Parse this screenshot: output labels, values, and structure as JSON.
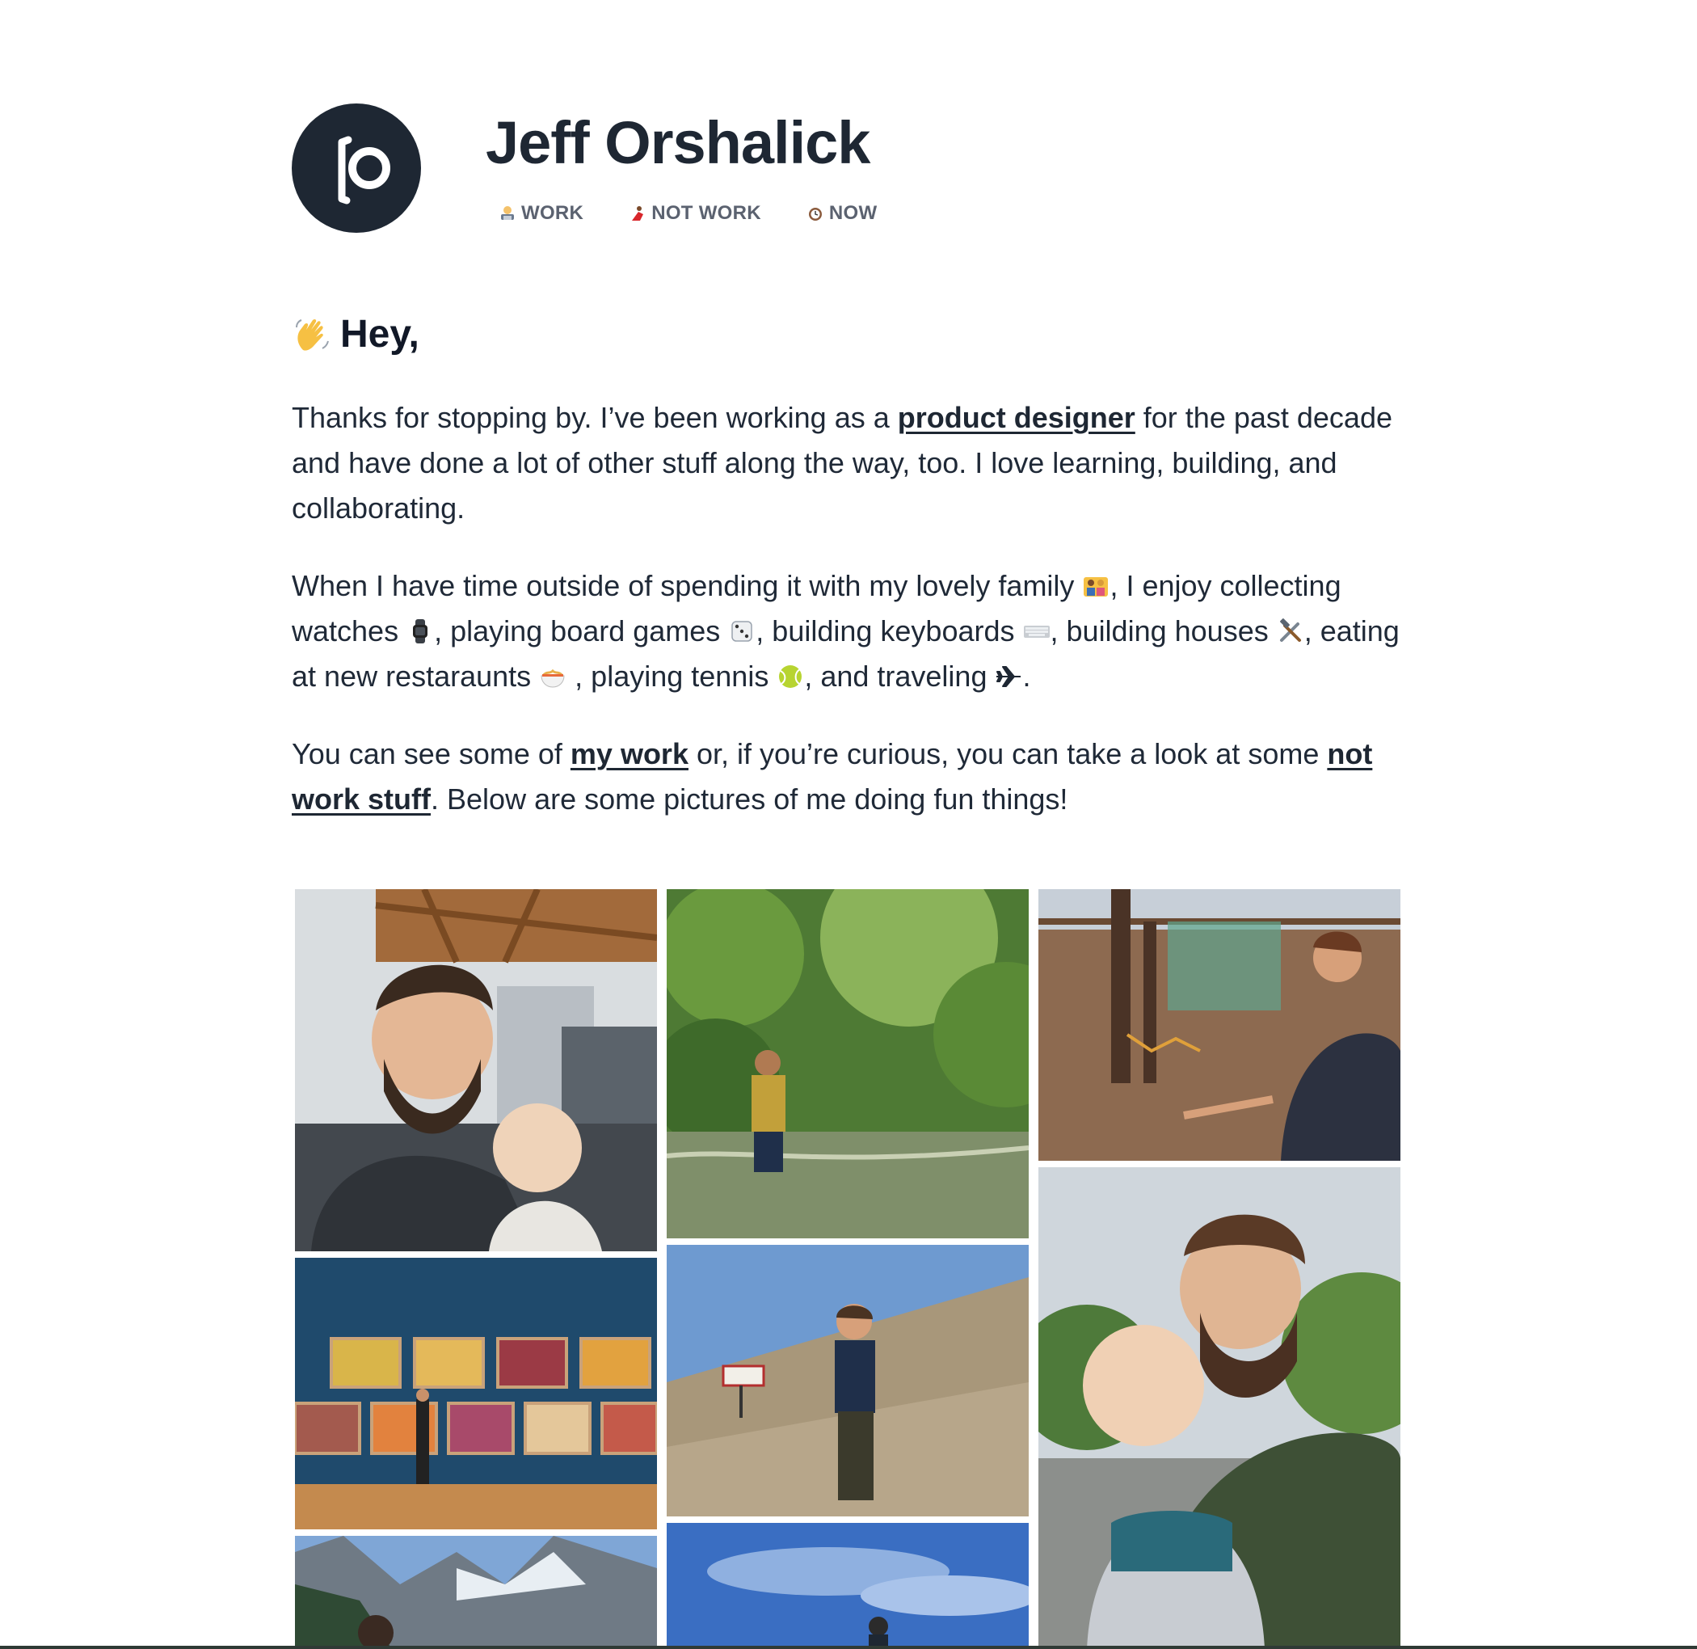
{
  "site": {
    "title": "Jeff Orshalick",
    "logo_icon": "jo-monogram-logo"
  },
  "nav": [
    {
      "label": "WORK",
      "icon": "technologist-icon"
    },
    {
      "label": "NOT WORK",
      "icon": "dancer-icon"
    },
    {
      "label": "NOW",
      "icon": "alarm-clock-icon"
    }
  ],
  "intro": {
    "greeting": "Hey,",
    "greeting_icon": "waving-hand-icon",
    "p1_before": "Thanks for stopping by. I’ve been working as a ",
    "p1_link": "product designer",
    "p1_after": " for the past decade and have done a lot of other stuff along the way, too. I love learning, building, and collaborating.",
    "p2_a": "When I have time outside of spending it with my lovely family ",
    "p2_b": ", I enjoy collecting watches ",
    "p2_c": ", playing board games ",
    "p2_d": ", building keyboards ",
    "p2_e": ", building houses ",
    "p2_f": ", eating at new restaraunts ",
    "p2_g": " , playing tennis ",
    "p2_h": ", and traveling ",
    "p2_i": ".",
    "p3_a": "You can see some of ",
    "p3_link1": "my work",
    "p3_b": " or, if you’re curious, you can take a look at some ",
    "p3_link2": "not work stuff",
    "p3_c": ". Below are some pictures of me doing fun things!"
  },
  "hobby_icons": [
    "family-icon",
    "watch-icon",
    "dice-icon",
    "keyboard-icon",
    "hammer-wrench-icon",
    "noodle-bowl-icon",
    "tennis-ball-icon",
    "airplane-icon"
  ],
  "colors": {
    "text": "#1f2937",
    "heading": "#1e2733",
    "nav": "#5b6270",
    "logo_bg": "#1e2733"
  }
}
